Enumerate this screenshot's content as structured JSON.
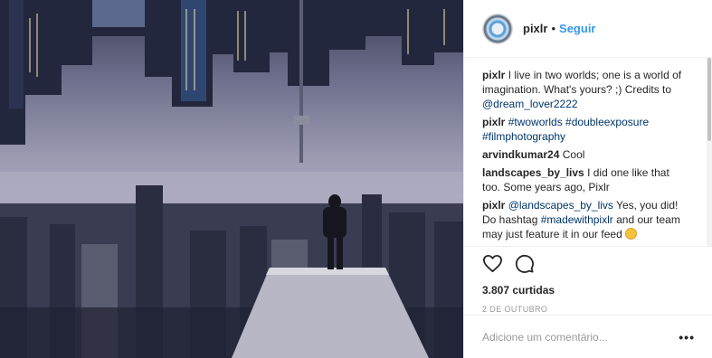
{
  "header": {
    "username": "pixlr",
    "separator": "•",
    "follow_label": "Seguir"
  },
  "comments": [
    {
      "user": "pixlr",
      "parts": [
        "I live in two worlds; one is a world of imagination. What's yours? ;) Credits to ",
        "@dream_lover2222"
      ]
    },
    {
      "user": "pixlr",
      "parts": [
        "#twoworlds #doubleexposure #filmphotography"
      ]
    },
    {
      "user": "arvindkumar24",
      "parts": [
        "Cool"
      ]
    },
    {
      "user": "landscapes_by_livs",
      "parts": [
        "I did one like that too. Some years ago, Pixlr"
      ]
    },
    {
      "user": "pixlr",
      "parts": [
        "@landscapes_by_livs",
        " Yes, you did! Do hashtag ",
        "#madewithpixlr",
        " and our team may just feature it in our feed "
      ]
    }
  ],
  "actions": {
    "like_icon": "heart-icon",
    "comment_icon": "comment-icon"
  },
  "likes": "3.807 curtidas",
  "date": "2 DE OUTUBRO",
  "add_comment": {
    "placeholder": "Adicione um comentário...",
    "more_label": "•••"
  }
}
